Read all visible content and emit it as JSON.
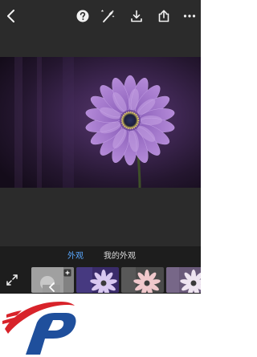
{
  "toolbar": {
    "back_icon": "chevron-left-icon",
    "help_icon": "question-circle-icon",
    "magic_icon": "magic-wand-icon",
    "download_icon": "download-icon",
    "share_icon": "share-icon",
    "more_icon": "more-horizontal-icon"
  },
  "looks": {
    "tabs": [
      {
        "label": "外观",
        "active": true
      },
      {
        "label": "我的外观",
        "active": false
      }
    ]
  },
  "colors": {
    "accent": "#5aa8ff",
    "app_background": "#2b2b2b",
    "panel_background": "#1d1d1d",
    "logo_red": "#d8232a",
    "logo_blue": "#1f4f9c"
  }
}
